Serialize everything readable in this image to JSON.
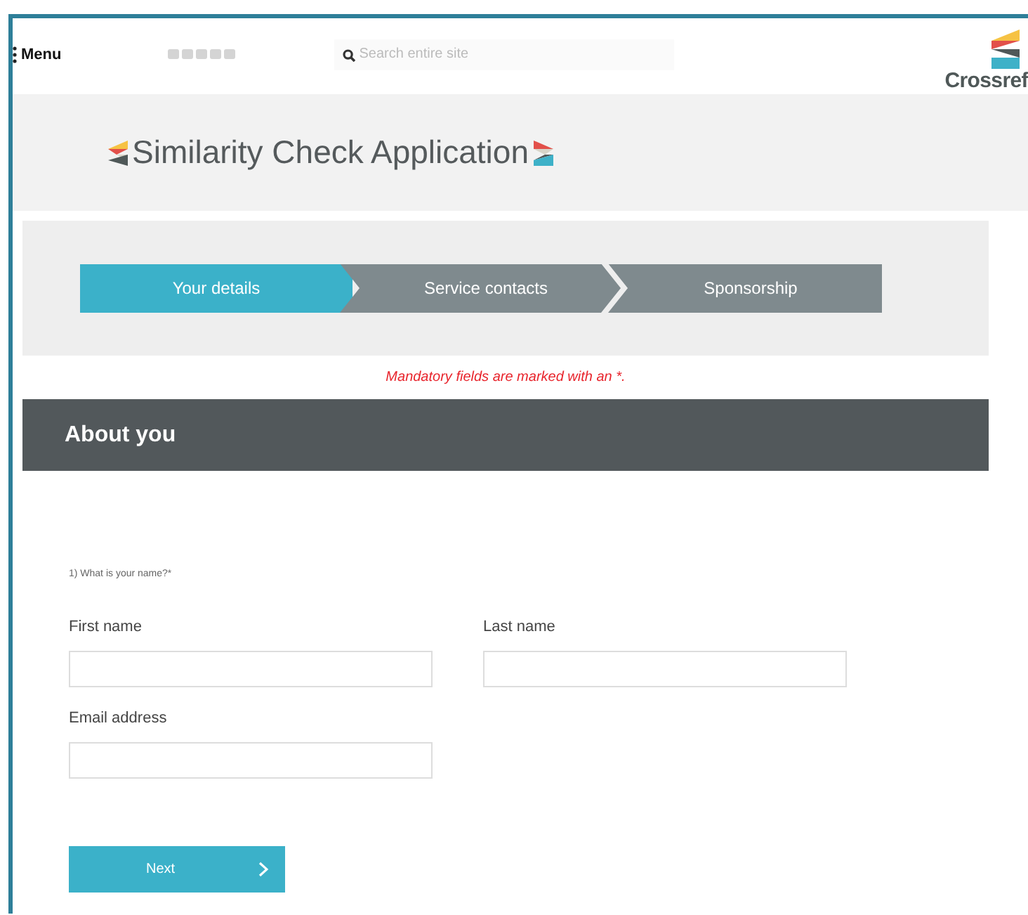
{
  "header": {
    "menu": "Menu",
    "search": {
      "placeholder": "Search entire site"
    },
    "logo": "Crossref"
  },
  "banner": {
    "title": "Similarity Check Application"
  },
  "steps": [
    {
      "label": "Your details",
      "selected": true
    },
    {
      "label": "Service contacts",
      "selected": false
    },
    {
      "label": "Sponsorship",
      "selected": false
    }
  ],
  "notice": "Mandatory fields are marked with an *.",
  "section": {
    "title": "About you"
  },
  "question": "1) What is your name?*",
  "fields": [
    {
      "label": "First name"
    },
    {
      "label": "Last name"
    },
    {
      "label": "Email address"
    }
  ],
  "next_button": "Next"
}
